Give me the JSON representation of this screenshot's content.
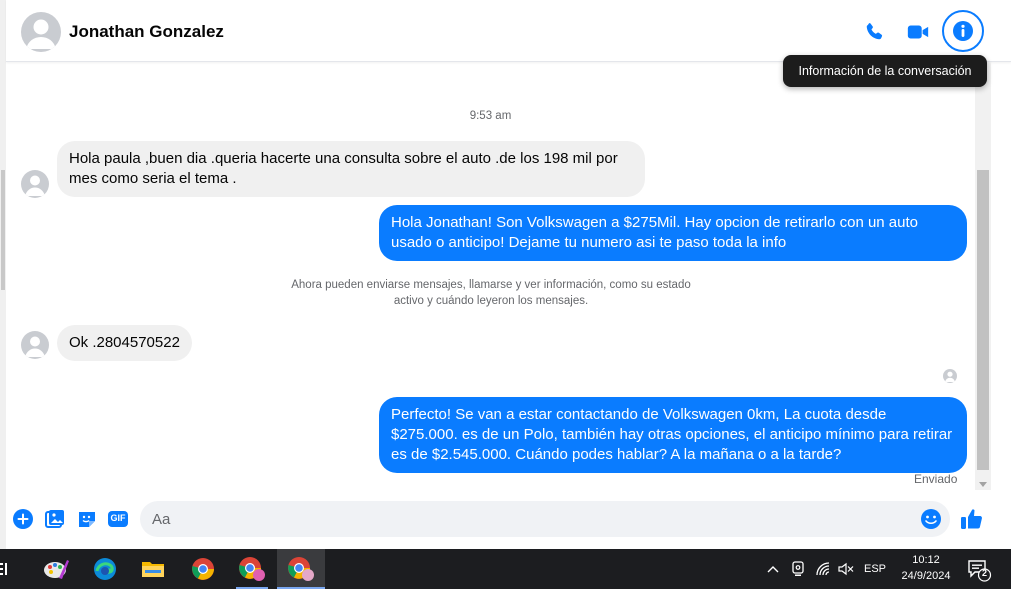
{
  "header": {
    "contact_name": "Jonathan Gonzalez",
    "tooltip": "Información de la conversación"
  },
  "conversation": {
    "timestamp": "9:53 am",
    "messages": [
      {
        "direction": "incoming",
        "text": "Hola paula ,buen dia .queria hacerte una consulta sobre el auto .de los 198 mil por mes como seria el tema ."
      },
      {
        "direction": "outgoing",
        "text": "Hola Jonathan! Son Volkswagen a $275Mil. Hay opcion de retirarlo con un auto usado o anticipo! Dejame tu numero asi te paso toda la info"
      },
      {
        "direction": "incoming",
        "text": "Ok .2804570522"
      },
      {
        "direction": "outgoing",
        "text": "Perfecto!  Se van a estar contactando de Volkswagen 0km, La cuota desde $275.000. es de un Polo, también hay otras opciones, el anticipo mínimo para retirar es de $2.545.000. Cuándo podes hablar? A la mañana o a la tarde?"
      }
    ],
    "system_note": "Ahora pueden enviarse mensajes, llamarse y ver información, como su estado activo y cuándo leyeron los mensajes.",
    "sent_status": "Enviado"
  },
  "composer": {
    "placeholder": "Aa",
    "gif_label": "GIF"
  },
  "taskbar": {
    "language": "ESP",
    "time": "10:12",
    "date": "24/9/2024",
    "notification_count": "2"
  },
  "colors": {
    "accent": "#0a7cff",
    "incoming_bubble": "#f0f0f0",
    "taskbar": "#1c1d20"
  }
}
